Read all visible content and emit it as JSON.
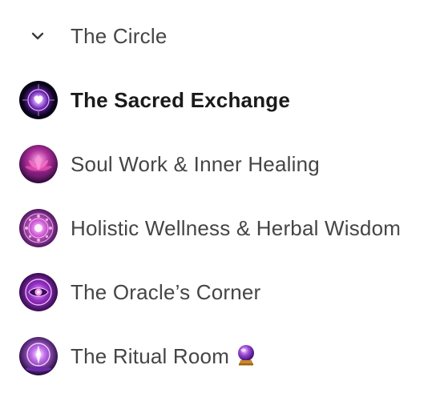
{
  "group": {
    "title": "The Circle",
    "expanded": true
  },
  "channels": [
    {
      "label": "The Sacred Exchange",
      "icon": "sacred-heart-orb-icon",
      "active": true
    },
    {
      "label": "Soul Work & Inner Healing",
      "icon": "lotus-icon",
      "active": false
    },
    {
      "label": "Holistic Wellness & Herbal Wisdom",
      "icon": "herbal-mandala-icon",
      "active": false
    },
    {
      "label": "The Oracle’s Corner",
      "icon": "oracle-eye-icon",
      "active": false
    },
    {
      "label": "The Ritual Room",
      "icon": "ritual-circle-icon",
      "active": false,
      "emoji": "crystal-ball-icon"
    }
  ],
  "colors": {
    "accent": "#9b3bd6",
    "text": "#454545",
    "active_text": "#1a1a1a"
  }
}
